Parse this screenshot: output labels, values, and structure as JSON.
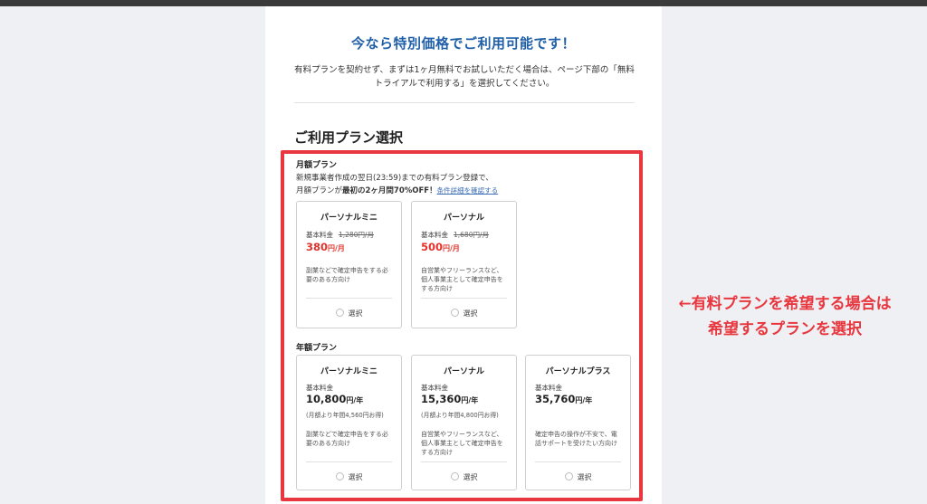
{
  "headline": "今なら特別価格でご利用可能です！",
  "intro": "有料プランを契約せず、まずは1ヶ月無料でお試しいただく場合は、ページ下部の「無料トライアルで利用する」を選択してください。",
  "section_title": "ご利用プラン選択",
  "monthly": {
    "label": "月額プラン",
    "promo_line1": "新規事業者作成の翌日(23:59)までの有料プラン登録で、",
    "promo_prefix": "月額プランが",
    "promo_bold": "最初の2ヶ月間70%OFF！",
    "promo_link": "条件詳細を確認する",
    "cards": [
      {
        "name": "パーソナルミニ",
        "base_label": "基本料金",
        "old_price": "1,280円/月",
        "price": "380",
        "unit": "円/月",
        "desc": "副業などで確定申告をする必要のある方向け",
        "select": "選択"
      },
      {
        "name": "パーソナル",
        "base_label": "基本料金",
        "old_price": "1,680円/月",
        "price": "500",
        "unit": "円/月",
        "desc": "自営業やフリーランスなど、個人事業主として確定申告をする方向け",
        "select": "選択"
      }
    ]
  },
  "yearly": {
    "label": "年額プラン",
    "cards": [
      {
        "name": "パーソナルミニ",
        "base_label": "基本料金",
        "price": "10,800",
        "unit": "円/年",
        "note": "(月額より年間4,560円お得)",
        "desc": "副業などで確定申告をする必要のある方向け",
        "select": "選択"
      },
      {
        "name": "パーソナル",
        "base_label": "基本料金",
        "price": "15,360",
        "unit": "円/年",
        "note": "(月額より年間4,800円お得)",
        "desc": "自営業やフリーランスなど、個人事業主として確定申告をする方向け",
        "select": "選択"
      },
      {
        "name": "パーソナルプラス",
        "base_label": "基本料金",
        "price": "35,760",
        "unit": "円/年",
        "desc": "確定申告の操作が不安で、電話サポートを受けたい方向け",
        "select": "選択"
      }
    ]
  },
  "annotation": {
    "line1": "←有料プランを希望する場合は",
    "line2": "希望するプランを選択"
  },
  "colors": {
    "accent_blue": "#1f5fa8",
    "price_red": "#e4322b",
    "highlight_red": "#e8373f"
  }
}
